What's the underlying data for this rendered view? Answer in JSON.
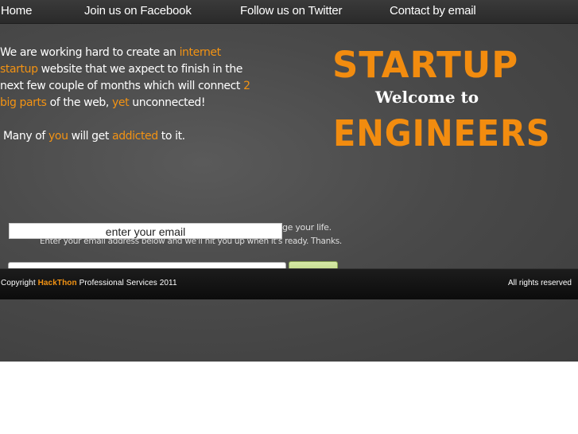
{
  "nav": {
    "home": "Home",
    "facebook": "Join us on Facebook",
    "twitter": "Follow us on Twitter",
    "email": "Contact by email"
  },
  "intro": {
    "l1_a": "We are working hard to create an ",
    "l1_hl": "internet",
    "l2_hl": "startup",
    "l2_b": " website that we axpect to finish in the",
    "l3_a": "next few couple of months which will connect ",
    "l3_hl": "2",
    "l4_hl1": "big parts",
    "l4_b": " of the web, ",
    "l4_hl2": "yet",
    "l4_c": " unconnected!",
    "l5_a": "Many of ",
    "l5_hl1": "you",
    "l5_b": " will get ",
    "l5_hl2": "addicted",
    "l5_c": " to it."
  },
  "logo": {
    "line1": "STARTUP",
    "line2": "Welcome to",
    "line3": "ENGINEERS"
  },
  "signup": {
    "line1_fragment": "ge your life.",
    "line2": "Enter your email address below and we'll hit you up when it's ready. Thanks.",
    "email_label": "enter your email"
  },
  "footer": {
    "copyright_prefix": "Copyright ",
    "brand": "HackThon",
    "copyright_suffix": " Professional Services 2011",
    "rights": "All rights reserved"
  },
  "colors": {
    "accent": "#f39313",
    "logo": "#f28c0f",
    "background": "#4a4a4a",
    "footer": "#111111"
  }
}
